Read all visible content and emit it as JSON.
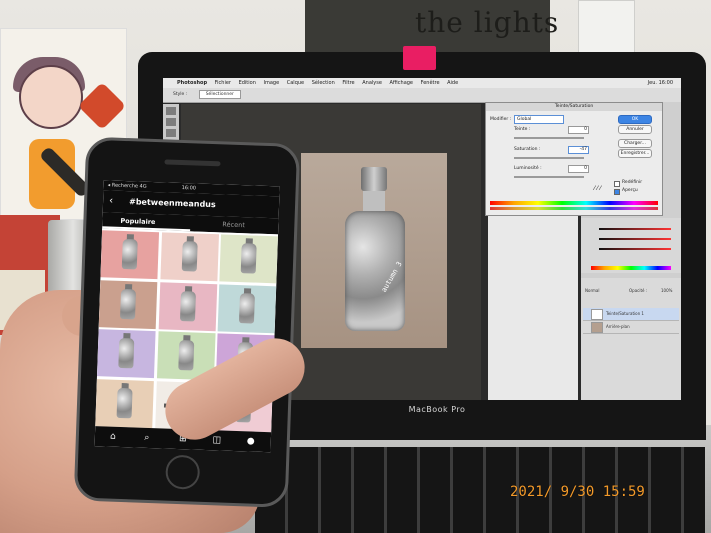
{
  "background": {
    "wall_sign_text": "the lights"
  },
  "laptop": {
    "model_label": "MacBook Pro",
    "menubar": {
      "items": [
        "Photoshop",
        "Fichier",
        "Edition",
        "Image",
        "Calque",
        "Sélection",
        "Filtre",
        "Analyse",
        "Affichage",
        "Fenêtre",
        "Aide"
      ],
      "clock": "Jeu. 16:00"
    },
    "options_bar": {
      "label": "Style :",
      "select_value": "Sélectionner"
    },
    "photo": {
      "bottle_label": "autumn 3"
    },
    "dialog": {
      "title": "Teinte/Saturation",
      "modify_label": "Modifier :",
      "modify_value": "Global",
      "hue_label": "Teinte :",
      "hue_value": "0",
      "saturation_label": "Saturation :",
      "saturation_value": "-47",
      "lightness_label": "Luminosité :",
      "lightness_value": "0",
      "ok_label": "OK",
      "cancel_label": "Annuler",
      "load_label": "Charger...",
      "save_label": "Enregistrer...",
      "colorize_label": "Redéfinir",
      "preview_label": "Aperçu"
    },
    "layers": {
      "blend_mode": "Normal",
      "opacity_label": "Opacité :",
      "opacity_value": "100%",
      "layer_1": "Teinte/Saturation 1",
      "layer_2": "Arrière-plan"
    }
  },
  "phone": {
    "status": {
      "carrier": "◂ Recherche  4G",
      "time": "16:00"
    },
    "hashtag": "#betweenmeandus",
    "tabs": {
      "popular": "Populaire",
      "recent": "Récent"
    },
    "thumbnails": [
      {
        "bg": "#e7a2a0"
      },
      {
        "bg": "#efd0c9"
      },
      {
        "bg": "#dee5c8"
      },
      {
        "bg": "#caa08e"
      },
      {
        "bg": "#e8b7c3"
      },
      {
        "bg": "#bfd9d9"
      },
      {
        "bg": "#c7b6e0"
      },
      {
        "bg": "#c9dfb7"
      },
      {
        "bg": "#cda5d8"
      },
      {
        "bg": "#e8cfb6"
      },
      {
        "bg": "#f1ece6"
      },
      {
        "bg": "#f0ccd4"
      }
    ],
    "nav_icons": [
      "home-icon",
      "search-icon",
      "add-icon",
      "shop-icon",
      "profile-icon"
    ]
  },
  "timestamp": "2021/ 9/30 15:59",
  "colors": {
    "timestamp": "#f39a2a",
    "camera_tab": "#e91e63",
    "ok_button": "#3d85e4"
  }
}
